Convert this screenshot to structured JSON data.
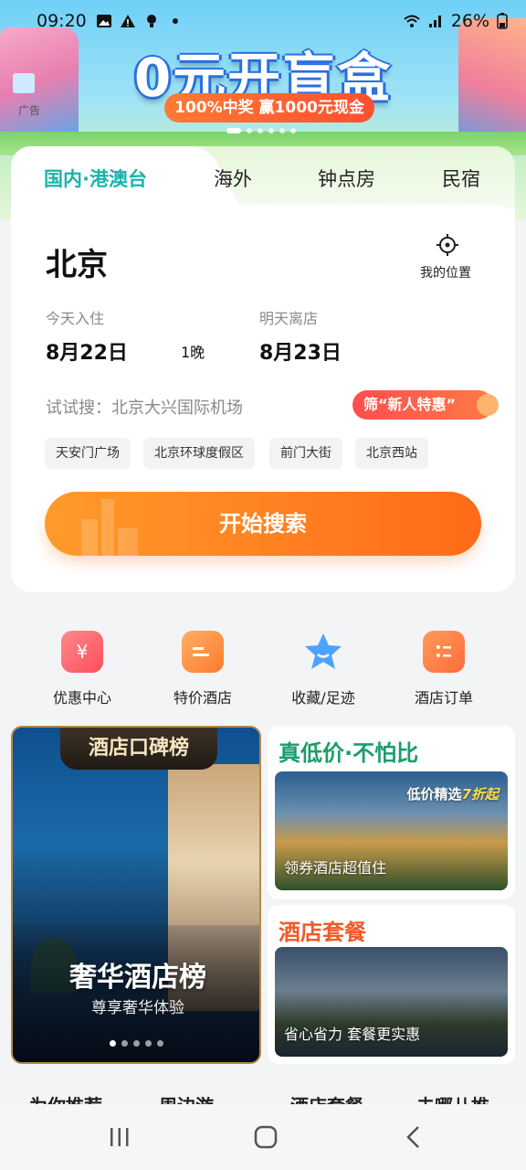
{
  "status_bar": {
    "time": "09:20",
    "battery": "26%"
  },
  "banner": {
    "title": "0元开盲盒",
    "subtitle": "100%中奖 赢1000元现金",
    "ad_label": "广告"
  },
  "tabs": [
    {
      "label": "国内·港澳台",
      "active": true
    },
    {
      "label": "海外",
      "active": false
    },
    {
      "label": "钟点房",
      "active": false
    },
    {
      "label": "民宿",
      "active": false
    }
  ],
  "booking": {
    "city": "北京",
    "my_location": "我的位置",
    "checkin_label": "今天入住",
    "checkin_date": "8月22日",
    "nights": "1晚",
    "checkout_label": "明天离店",
    "checkout_date": "8月23日",
    "suggest_text": "试试搜：北京大兴国际机场",
    "promo": "筛“新人特惠”",
    "chips": [
      "天安门广场",
      "北京环球度假区",
      "前门大街",
      "北京西站"
    ],
    "search_button": "开始搜索"
  },
  "quick_links": [
    {
      "label": "优惠中心",
      "icon": "coupon-icon"
    },
    {
      "label": "特价酒店",
      "icon": "deal-icon"
    },
    {
      "label": "收藏/足迹",
      "icon": "star-icon"
    },
    {
      "label": "酒店订单",
      "icon": "order-icon"
    }
  ],
  "luxury_card": {
    "badge": "酒店口碑榜",
    "title": "奢华酒店榜",
    "subtitle": "尊享奢华体验"
  },
  "low_price_card": {
    "title": "真低价·不怕比",
    "tag": "低价精选",
    "tag_discount": "7折起",
    "caption": "领券酒店超值住"
  },
  "package_card": {
    "title": "酒店套餐",
    "caption": "省心省力 套餐更实惠"
  },
  "peek_tabs": [
    "为你推荐",
    "周边游",
    "酒店套餐",
    "去哪儿推"
  ],
  "colors": {
    "accent": "#1bb3ad",
    "orange": "#ff7a1f",
    "green_title": "#1a9e6a",
    "red_title": "#f05a28"
  }
}
